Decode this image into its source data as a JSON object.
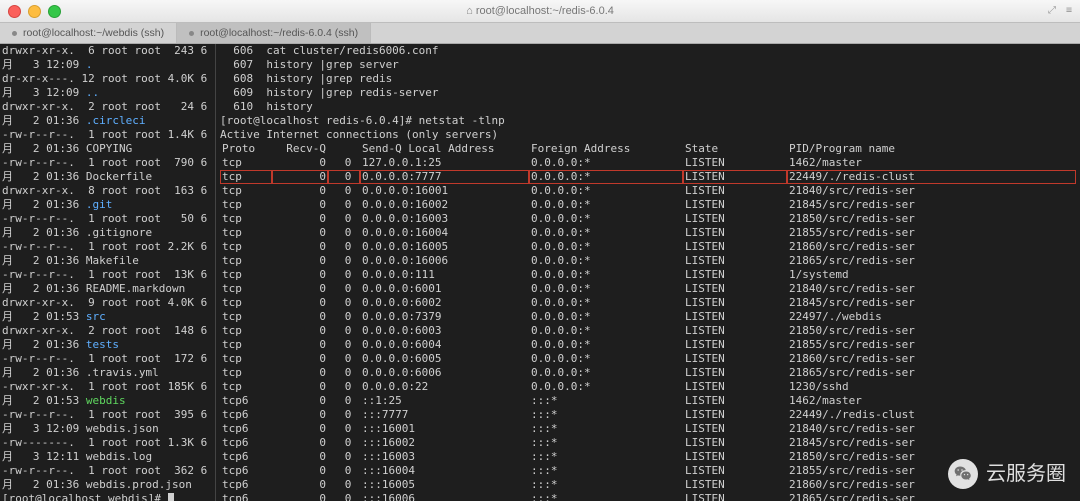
{
  "window": {
    "title": "root@localhost:~/redis-6.0.4",
    "expand_hint": "⤢",
    "menu_hint": "≡"
  },
  "tabs": [
    {
      "label": "root@localhost:~/webdis (ssh)",
      "active": false
    },
    {
      "label": "root@localhost:~/redis-6.0.4 (ssh)",
      "active": true
    }
  ],
  "left_pane": {
    "entries": [
      {
        "perm": "drwxr-xr-x.",
        "links": "6",
        "own": "root root",
        "size": "243",
        "date": "6",
        "wrap": "月   3 12:09",
        "name": ".",
        "cls": "blue"
      },
      {
        "perm": "dr-xr-x---.",
        "links": "12",
        "own": "root root",
        "size": "4.0K",
        "date": "6",
        "wrap": "月   3 12:09",
        "name": "..",
        "cls": "blue"
      },
      {
        "perm": "drwxr-xr-x.",
        "links": "2",
        "own": "root root",
        "size": "24",
        "date": "6",
        "wrap": "月   2 01:36",
        "name": ".circleci",
        "cls": "blue"
      },
      {
        "perm": "-rw-r--r--.",
        "links": "1",
        "own": "root root",
        "size": "1.4K",
        "date": "6",
        "wrap": "月   2 01:36",
        "name": "COPYING",
        "cls": ""
      },
      {
        "perm": "-rw-r--r--.",
        "links": "1",
        "own": "root root",
        "size": "790",
        "date": "6",
        "wrap": "月   2 01:36",
        "name": "Dockerfile",
        "cls": ""
      },
      {
        "perm": "drwxr-xr-x.",
        "links": "8",
        "own": "root root",
        "size": "163",
        "date": "6",
        "wrap": "月   2 01:36",
        "name": ".git",
        "cls": "blue"
      },
      {
        "perm": "-rw-r--r--.",
        "links": "1",
        "own": "root root",
        "size": "50",
        "date": "6",
        "wrap": "月   2 01:36",
        "name": ".gitignore",
        "cls": ""
      },
      {
        "perm": "-rw-r--r--.",
        "links": "1",
        "own": "root root",
        "size": "2.2K",
        "date": "6",
        "wrap": "月   2 01:36",
        "name": "Makefile",
        "cls": ""
      },
      {
        "perm": "-rw-r--r--.",
        "links": "1",
        "own": "root root",
        "size": "13K",
        "date": "6",
        "wrap": "月   2 01:36",
        "name": "README.markdown",
        "cls": ""
      },
      {
        "perm": "drwxr-xr-x.",
        "links": "9",
        "own": "root root",
        "size": "4.0K",
        "date": "6",
        "wrap": "月   2 01:53",
        "name": "src",
        "cls": "blue"
      },
      {
        "perm": "drwxr-xr-x.",
        "links": "2",
        "own": "root root",
        "size": "148",
        "date": "6",
        "wrap": "月   2 01:36",
        "name": "tests",
        "cls": "blue"
      },
      {
        "perm": "-rw-r--r--.",
        "links": "1",
        "own": "root root",
        "size": "172",
        "date": "6",
        "wrap": "月   2 01:36",
        "name": ".travis.yml",
        "cls": ""
      },
      {
        "perm": "-rwxr-xr-x.",
        "links": "1",
        "own": "root root",
        "size": "185K",
        "date": "6",
        "wrap": "月   2 01:53",
        "name": "webdis",
        "cls": "green"
      },
      {
        "perm": "-rw-r--r--.",
        "links": "1",
        "own": "root root",
        "size": "395",
        "date": "6",
        "wrap": "月   3 12:09",
        "name": "webdis.json",
        "cls": ""
      },
      {
        "perm": "-rw-------.",
        "links": "1",
        "own": "root root",
        "size": "1.3K",
        "date": "6",
        "wrap": "月   3 12:11",
        "name": "webdis.log",
        "cls": ""
      },
      {
        "perm": "-rw-r--r--.",
        "links": "1",
        "own": "root root",
        "size": "362",
        "date": "6",
        "wrap": "月   2 01:36",
        "name": "webdis.prod.json",
        "cls": ""
      }
    ],
    "prompt": "[root@localhost webdis]# "
  },
  "right_pane": {
    "history": [
      {
        "n": "606",
        "cmd": "cat cluster/redis6006.conf"
      },
      {
        "n": "607",
        "cmd": "history |grep server"
      },
      {
        "n": "608",
        "cmd": "history |grep redis"
      },
      {
        "n": "609",
        "cmd": "history |grep redis-server"
      },
      {
        "n": "610",
        "cmd": "history"
      }
    ],
    "prompt_line": "[root@localhost redis-6.0.4]# netstat -tlnp",
    "active_conn": "Active Internet connections (only servers)",
    "headers": {
      "proto": "Proto",
      "rq": "Recv-Q",
      "sq": "Send-Q",
      "la": "Local Address",
      "fa": "Foreign Address",
      "st": "State",
      "pid": "PID/Program name"
    },
    "rows": [
      {
        "proto": "tcp",
        "rq": "0",
        "sq": "0",
        "la": "127.0.0.1:25",
        "fa": "0.0.0.0:*",
        "st": "LISTEN",
        "pid": "1462/master",
        "hi": false
      },
      {
        "proto": "tcp",
        "rq": "0",
        "sq": "0",
        "la": "0.0.0.0:7777",
        "fa": "0.0.0.0:*",
        "st": "LISTEN",
        "pid": "22449/./redis-clust",
        "hi": true
      },
      {
        "proto": "tcp",
        "rq": "0",
        "sq": "0",
        "la": "0.0.0.0:16001",
        "fa": "0.0.0.0:*",
        "st": "LISTEN",
        "pid": "21840/src/redis-ser",
        "hi": false
      },
      {
        "proto": "tcp",
        "rq": "0",
        "sq": "0",
        "la": "0.0.0.0:16002",
        "fa": "0.0.0.0:*",
        "st": "LISTEN",
        "pid": "21845/src/redis-ser",
        "hi": false
      },
      {
        "proto": "tcp",
        "rq": "0",
        "sq": "0",
        "la": "0.0.0.0:16003",
        "fa": "0.0.0.0:*",
        "st": "LISTEN",
        "pid": "21850/src/redis-ser",
        "hi": false
      },
      {
        "proto": "tcp",
        "rq": "0",
        "sq": "0",
        "la": "0.0.0.0:16004",
        "fa": "0.0.0.0:*",
        "st": "LISTEN",
        "pid": "21855/src/redis-ser",
        "hi": false
      },
      {
        "proto": "tcp",
        "rq": "0",
        "sq": "0",
        "la": "0.0.0.0:16005",
        "fa": "0.0.0.0:*",
        "st": "LISTEN",
        "pid": "21860/src/redis-ser",
        "hi": false
      },
      {
        "proto": "tcp",
        "rq": "0",
        "sq": "0",
        "la": "0.0.0.0:16006",
        "fa": "0.0.0.0:*",
        "st": "LISTEN",
        "pid": "21865/src/redis-ser",
        "hi": false
      },
      {
        "proto": "tcp",
        "rq": "0",
        "sq": "0",
        "la": "0.0.0.0:111",
        "fa": "0.0.0.0:*",
        "st": "LISTEN",
        "pid": "1/systemd",
        "hi": false
      },
      {
        "proto": "tcp",
        "rq": "0",
        "sq": "0",
        "la": "0.0.0.0:6001",
        "fa": "0.0.0.0:*",
        "st": "LISTEN",
        "pid": "21840/src/redis-ser",
        "hi": false
      },
      {
        "proto": "tcp",
        "rq": "0",
        "sq": "0",
        "la": "0.0.0.0:6002",
        "fa": "0.0.0.0:*",
        "st": "LISTEN",
        "pid": "21845/src/redis-ser",
        "hi": false
      },
      {
        "proto": "tcp",
        "rq": "0",
        "sq": "0",
        "la": "0.0.0.0:7379",
        "fa": "0.0.0.0:*",
        "st": "LISTEN",
        "pid": "22497/./webdis",
        "hi": false
      },
      {
        "proto": "tcp",
        "rq": "0",
        "sq": "0",
        "la": "0.0.0.0:6003",
        "fa": "0.0.0.0:*",
        "st": "LISTEN",
        "pid": "21850/src/redis-ser",
        "hi": false
      },
      {
        "proto": "tcp",
        "rq": "0",
        "sq": "0",
        "la": "0.0.0.0:6004",
        "fa": "0.0.0.0:*",
        "st": "LISTEN",
        "pid": "21855/src/redis-ser",
        "hi": false
      },
      {
        "proto": "tcp",
        "rq": "0",
        "sq": "0",
        "la": "0.0.0.0:6005",
        "fa": "0.0.0.0:*",
        "st": "LISTEN",
        "pid": "21860/src/redis-ser",
        "hi": false
      },
      {
        "proto": "tcp",
        "rq": "0",
        "sq": "0",
        "la": "0.0.0.0:6006",
        "fa": "0.0.0.0:*",
        "st": "LISTEN",
        "pid": "21865/src/redis-ser",
        "hi": false
      },
      {
        "proto": "tcp",
        "rq": "0",
        "sq": "0",
        "la": "0.0.0.0:22",
        "fa": "0.0.0.0:*",
        "st": "LISTEN",
        "pid": "1230/sshd",
        "hi": false
      },
      {
        "proto": "tcp6",
        "rq": "0",
        "sq": "0",
        "la": "::1:25",
        "fa": ":::*",
        "st": "LISTEN",
        "pid": "1462/master",
        "hi": false
      },
      {
        "proto": "tcp6",
        "rq": "0",
        "sq": "0",
        "la": ":::7777",
        "fa": ":::*",
        "st": "LISTEN",
        "pid": "22449/./redis-clust",
        "hi": false
      },
      {
        "proto": "tcp6",
        "rq": "0",
        "sq": "0",
        "la": ":::16001",
        "fa": ":::*",
        "st": "LISTEN",
        "pid": "21840/src/redis-ser",
        "hi": false
      },
      {
        "proto": "tcp6",
        "rq": "0",
        "sq": "0",
        "la": ":::16002",
        "fa": ":::*",
        "st": "LISTEN",
        "pid": "21845/src/redis-ser",
        "hi": false
      },
      {
        "proto": "tcp6",
        "rq": "0",
        "sq": "0",
        "la": ":::16003",
        "fa": ":::*",
        "st": "LISTEN",
        "pid": "21850/src/redis-ser",
        "hi": false
      },
      {
        "proto": "tcp6",
        "rq": "0",
        "sq": "0",
        "la": ":::16004",
        "fa": ":::*",
        "st": "LISTEN",
        "pid": "21855/src/redis-ser",
        "hi": false
      },
      {
        "proto": "tcp6",
        "rq": "0",
        "sq": "0",
        "la": ":::16005",
        "fa": ":::*",
        "st": "LISTEN",
        "pid": "21860/src/redis-ser",
        "hi": false
      },
      {
        "proto": "tcp6",
        "rq": "0",
        "sq": "0",
        "la": ":::16006",
        "fa": ":::*",
        "st": "LISTEN",
        "pid": "21865/src/redis-ser",
        "hi": false
      }
    ]
  },
  "watermark": "云服务圈"
}
